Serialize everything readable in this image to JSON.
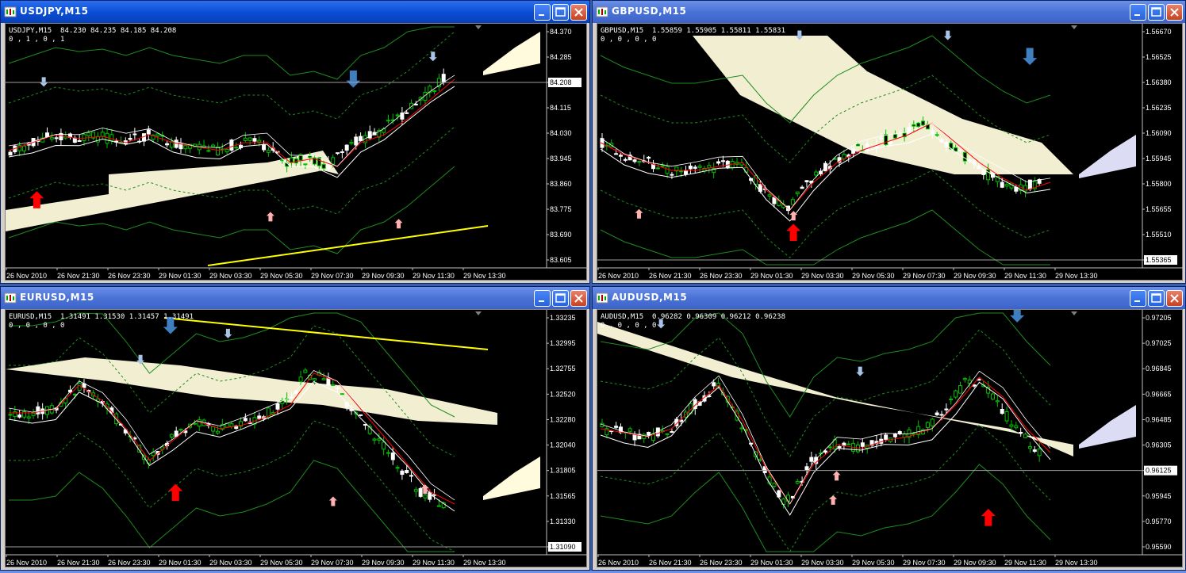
{
  "windows": [
    {
      "id": "usdjpy",
      "title": "USDJPY,M15",
      "active": true,
      "header_line1": "USDJPY,M15  84.230 84.235 84.185 84.208",
      "header_line2": "0 , 1 , 0 , 1",
      "current_price": "84.208",
      "price_labels": [
        "84.370",
        "84.285",
        "84.208",
        "84.115",
        "84.030",
        "83.945",
        "83.860",
        "83.775",
        "83.690",
        "83.605"
      ],
      "time_labels": [
        "26 Nov 2010",
        "26 Nov 21:30",
        "26 Nov 23:30",
        "29 Nov 01:30",
        "29 Nov 03:30",
        "29 Nov 05:30",
        "29 Nov 07:30",
        "29 Nov 09:30",
        "29 Nov 11:30",
        "29 Nov 13:30"
      ]
    },
    {
      "id": "gbpusd",
      "title": "GBPUSD,M15",
      "active": false,
      "header_line1": "GBPUSD,M15  1.55859 1.55905 1.55811 1.55831",
      "header_line2": "0 , 0 , 0 , 0",
      "current_price": "1.55831",
      "price_labels": [
        "1.56670",
        "1.56525",
        "1.56380",
        "1.56235",
        "1.56090",
        "1.55945",
        "1.55800",
        "1.55655",
        "1.55510",
        "1.55365"
      ],
      "time_labels": [
        "26 Nov 2010",
        "26 Nov 21:30",
        "26 Nov 23:30",
        "29 Nov 01:30",
        "29 Nov 03:30",
        "29 Nov 05:30",
        "29 Nov 07:30",
        "29 Nov 09:30",
        "29 Nov 11:30",
        "29 Nov 13:30"
      ]
    },
    {
      "id": "eurusd",
      "title": "EURUSD,M15",
      "active": false,
      "header_line1": "EURUSD,M15  1.31491 1.31530 1.31457 1.31491",
      "header_line2": "0 , 0 , 0 , 0",
      "current_price": "1.31491",
      "price_labels": [
        "1.33235",
        "1.32995",
        "1.32755",
        "1.32520",
        "1.32280",
        "1.32040",
        "1.31805",
        "1.31565",
        "1.31330",
        "1.31090"
      ],
      "time_labels": [
        "26 Nov 2010",
        "26 Nov 21:30",
        "26 Nov 23:30",
        "29 Nov 01:30",
        "29 Nov 03:30",
        "29 Nov 05:30",
        "29 Nov 07:30",
        "29 Nov 09:30",
        "29 Nov 11:30",
        "29 Nov 13:30"
      ]
    },
    {
      "id": "audusd",
      "title": "AUDUSD,M15",
      "active": false,
      "header_line1": "AUDUSD,M15  0.96282 0.96309 0.96212 0.96238",
      "header_line2": "0 , 0 , 0 , 0",
      "current_price": "0.96238",
      "price_labels": [
        "0.97205",
        "0.97025",
        "0.96845",
        "0.96665",
        "0.96485",
        "0.96305",
        "0.96125",
        "0.95945",
        "0.95770",
        "0.95590"
      ],
      "time_labels": [
        "26 Nov 2010",
        "26 Nov 21:30",
        "26 Nov 23:30",
        "29 Nov 01:30",
        "29 Nov 03:30",
        "29 Nov 05:30",
        "29 Nov 07:30",
        "29 Nov 09:30",
        "29 Nov 11:30",
        "29 Nov 13:30"
      ]
    }
  ],
  "icons": {
    "app": "chart-window-icon",
    "minimize": "minimize-icon",
    "maximize": "maximize-icon",
    "close": "close-icon"
  },
  "colors": {
    "bull": "#00c000",
    "bear": "#ffffff",
    "cloud": "#fffbdc",
    "cloud_alt": "#dcdcf5",
    "ma_red": "#ff0000",
    "ma_yellow": "#ffff00",
    "arrow_up": "#ff0000",
    "arrow_down": "#6fa0d8"
  }
}
